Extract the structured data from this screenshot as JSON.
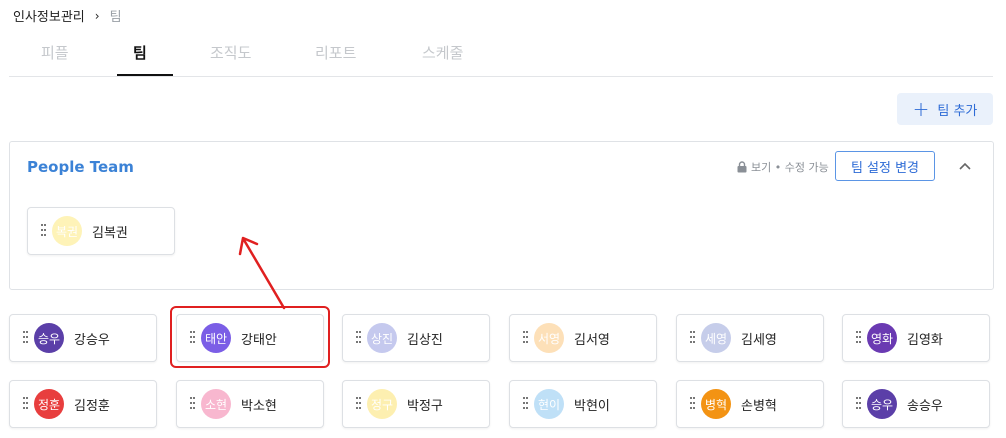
{
  "breadcrumb": {
    "root": "인사정보관리",
    "separator": "›",
    "current": "팀"
  },
  "tabs": [
    {
      "label": "피플",
      "active": false
    },
    {
      "label": "팀",
      "active": true
    },
    {
      "label": "조직도",
      "active": false
    },
    {
      "label": "리포트",
      "active": false
    },
    {
      "label": "스케줄",
      "active": false
    }
  ],
  "toolbar": {
    "add_team_label": "팀 추가"
  },
  "team": {
    "name": "People Team",
    "permission_text": "보기 • 수정 가능",
    "settings_label": "팀 설정 변경",
    "members": [
      {
        "avatar": "복권",
        "name": "김복권",
        "color": "#fef3b8"
      }
    ]
  },
  "unassigned": [
    {
      "avatar": "승우",
      "name": "강승우",
      "color": "#5b3fa8"
    },
    {
      "avatar": "태안",
      "name": "강태안",
      "color": "#7b5ee6"
    },
    {
      "avatar": "상진",
      "name": "김상진",
      "color": "#c5c9ee"
    },
    {
      "avatar": "서영",
      "name": "김서영",
      "color": "#fde0b8"
    },
    {
      "avatar": "세영",
      "name": "김세영",
      "color": "#c6cdea"
    },
    {
      "avatar": "영화",
      "name": "김영화",
      "color": "#6a3ab2"
    },
    {
      "avatar": "정훈",
      "name": "김정훈",
      "color": "#e83e3e"
    },
    {
      "avatar": "소현",
      "name": "박소현",
      "color": "#f8b7cf"
    },
    {
      "avatar": "정구",
      "name": "박정구",
      "color": "#fdefb0"
    },
    {
      "avatar": "현이",
      "name": "박현이",
      "color": "#bfe0f7"
    },
    {
      "avatar": "병혁",
      "name": "손병혁",
      "color": "#f39313"
    },
    {
      "avatar": "승우",
      "name": "송승우",
      "color": "#5b3fa8"
    }
  ],
  "colors": {
    "accent": "#3b82d6",
    "annotation": "#e02020"
  }
}
